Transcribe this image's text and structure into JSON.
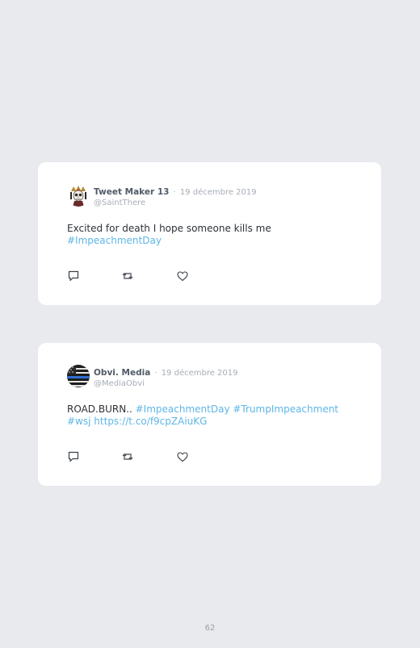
{
  "tweets": [
    {
      "name": "Tweet Maker 13",
      "separator": "·",
      "date": "19 décembre 2019",
      "handle": "@SaintThere",
      "text_plain": "Excited for death I hope someone kills me",
      "hashtag": "#ImpeachmentDay",
      "avatar_icon": "skull-avatar-icon"
    },
    {
      "name": "Obvi. Media",
      "separator": "·",
      "date": "19 décembre 2019",
      "handle": "@MediaObvi",
      "text_plain": "ROAD.BURN..",
      "hashtag1": "#ImpeachmentDay",
      "hashtag2": "#TrumpImpeachment",
      "hashtag3": "#wsj",
      "url": "https://t.co/f9cpZAiuKG",
      "avatar_icon": "flag-avatar-icon"
    }
  ],
  "actions": {
    "reply_icon": "reply-icon",
    "retweet_icon": "retweet-icon",
    "like_icon": "heart-icon"
  },
  "colors": {
    "background": "#e9eaee",
    "card": "#ffffff",
    "link": "#5eb6e6",
    "muted": "#a7adb5"
  },
  "page": {
    "number": "62"
  }
}
